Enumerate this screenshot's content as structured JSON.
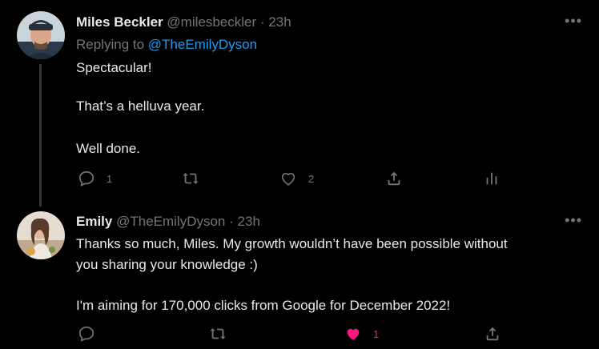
{
  "tweets": [
    {
      "name": "Miles Beckler",
      "handle": "@milesbeckler",
      "dot": "·",
      "time": "23h",
      "replying_prefix": "Replying to ",
      "replying_to": "@TheEmilyDyson",
      "more": "•••",
      "lines": [
        "Spectacular!",
        "That’s a helluva year.",
        "Well done."
      ],
      "reply_count": "1",
      "retweet_count": "",
      "like_count": "2",
      "liked": false
    },
    {
      "name": "Emily",
      "handle": "@TheEmilyDyson",
      "dot": "·",
      "time": "23h",
      "more": "•••",
      "lines": [
        "Thanks so much, Miles. My growth wouldn’t have been possible without",
        "you sharing your knowledge :)",
        "I'm aiming for 170,000 clicks from Google for December 2022!"
      ],
      "reply_count": "",
      "retweet_count": "",
      "like_count": "1",
      "liked": true
    }
  ],
  "colors": {
    "background": "#000000",
    "text": "#e7e9ea",
    "secondary": "#71767b",
    "link": "#1d9bf0",
    "like": "#f91880",
    "thread_line": "#333639"
  },
  "icons": [
    "reply-icon",
    "retweet-icon",
    "like-icon",
    "share-icon",
    "analytics-icon",
    "more-icon"
  ]
}
